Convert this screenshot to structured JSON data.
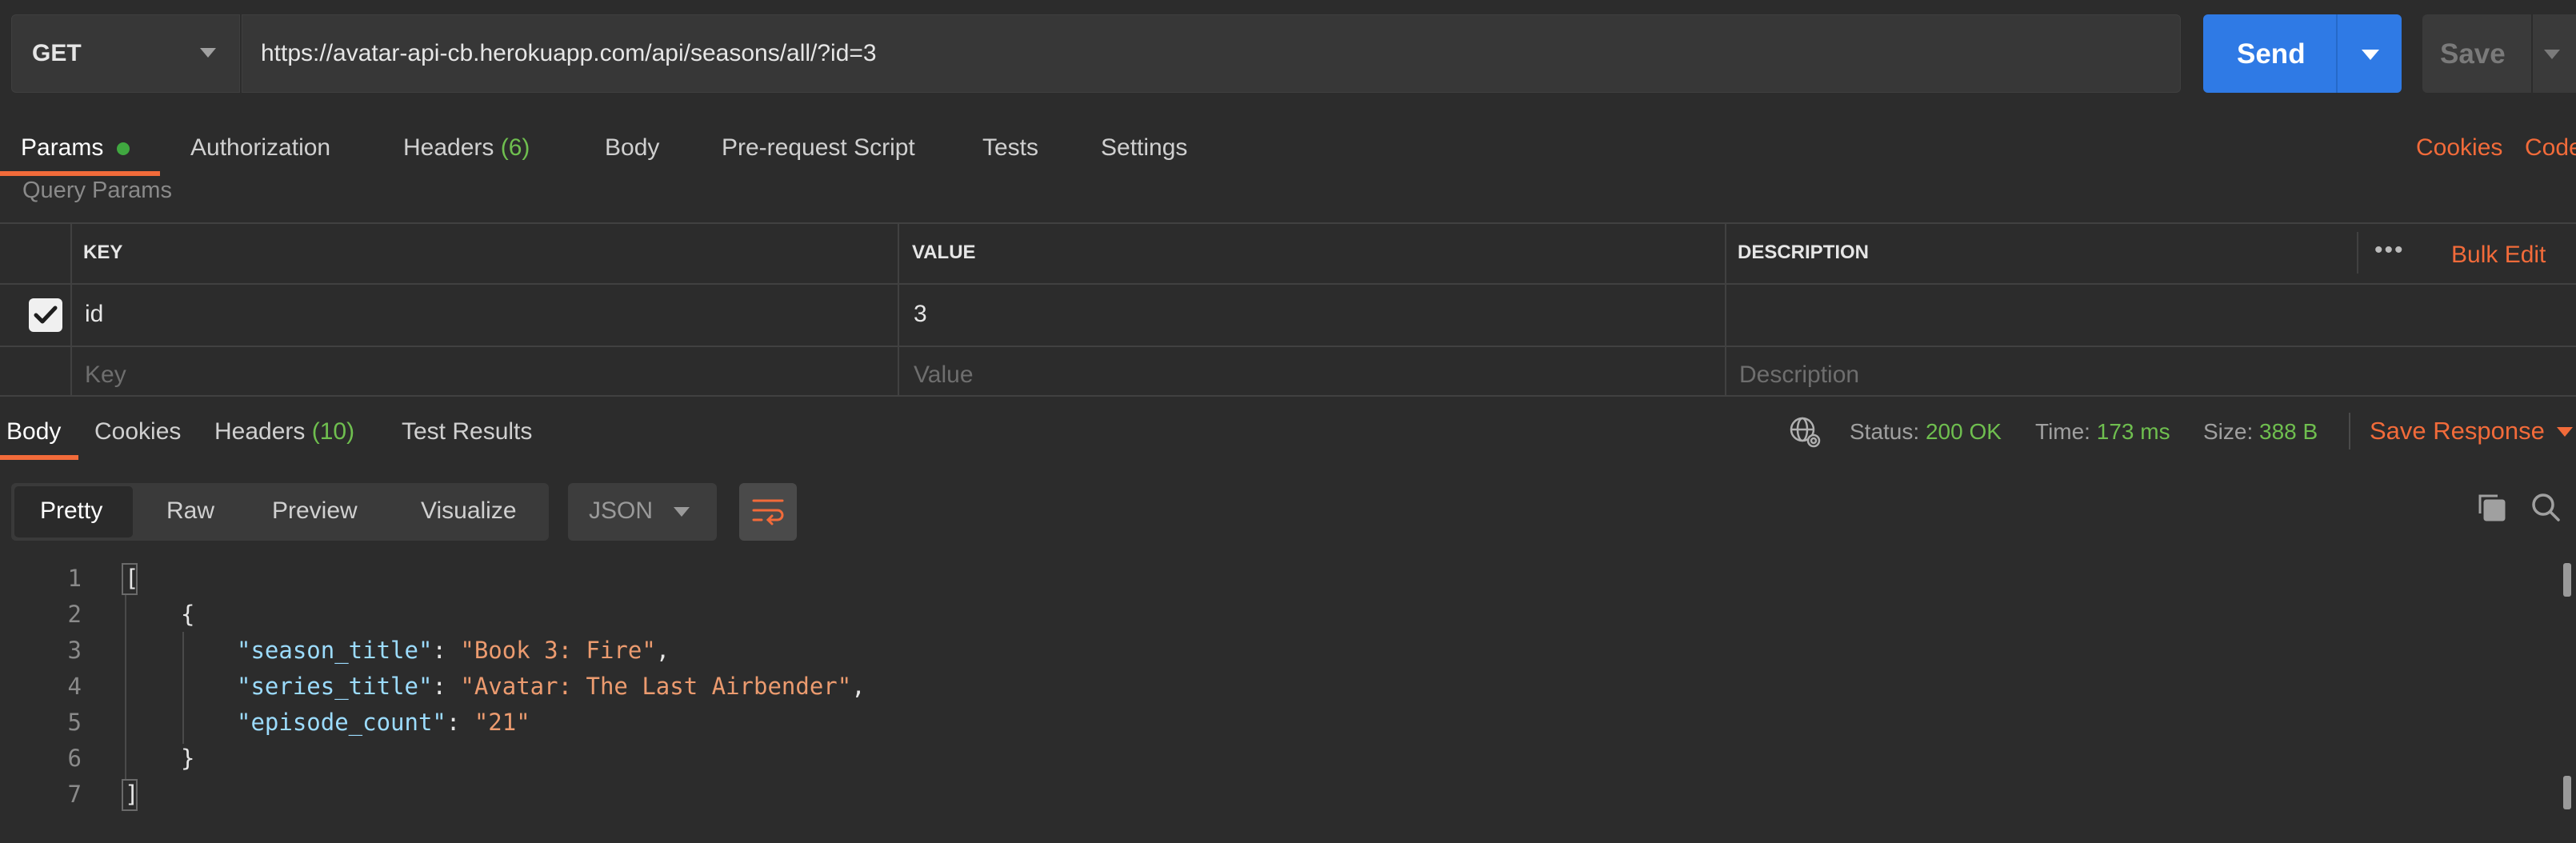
{
  "request": {
    "method": "GET",
    "url": "https://avatar-api-cb.herokuapp.com/api/seasons/all/?id=3",
    "send_label": "Send",
    "save_label": "Save"
  },
  "request_tabs": {
    "params": "Params",
    "authorization": "Authorization",
    "headers": "Headers",
    "headers_count": "(6)",
    "body": "Body",
    "prerequest": "Pre-request Script",
    "tests": "Tests",
    "settings": "Settings",
    "cookies": "Cookies",
    "code": "Code"
  },
  "params": {
    "section_title": "Query Params",
    "columns": {
      "key": "KEY",
      "value": "VALUE",
      "description": "DESCRIPTION"
    },
    "more_icon_glyph": "•••",
    "bulk_edit": "Bulk Edit",
    "rows": [
      {
        "key": "id",
        "value": "3",
        "description": "",
        "checked": true
      }
    ],
    "placeholders": {
      "key": "Key",
      "value": "Value",
      "description": "Description"
    }
  },
  "response_tabs": {
    "body": "Body",
    "cookies": "Cookies",
    "headers": "Headers",
    "headers_count": "(10)",
    "test_results": "Test Results"
  },
  "response_meta": {
    "status_label": "Status:",
    "status_value": "200 OK",
    "time_label": "Time:",
    "time_value": "173 ms",
    "size_label": "Size:",
    "size_value": "388 B",
    "save_response": "Save Response"
  },
  "view": {
    "modes": [
      "Pretty",
      "Raw",
      "Preview",
      "Visualize"
    ],
    "active": "Pretty",
    "format": "JSON"
  },
  "code": {
    "line_numbers": [
      "1",
      "2",
      "3",
      "4",
      "5",
      "6",
      "7"
    ],
    "open_array": "[",
    "open_obj": "{",
    "fields": [
      {
        "key": "\"season_title\"",
        "value": "\"Book 3: Fire\"",
        "trail": ","
      },
      {
        "key": "\"series_title\"",
        "value": "\"Avatar: The Last Airbender\"",
        "trail": ","
      },
      {
        "key": "\"episode_count\"",
        "value": "\"21\"",
        "trail": ""
      }
    ],
    "close_obj": "}",
    "close_array": "]"
  },
  "colors": {
    "accent": "#f26b3a",
    "send_blue": "#2f7ae5",
    "success_green": "#6fbf4f",
    "json_key": "#9cdcfe",
    "json_string": "#ec9b6f"
  },
  "icons": [
    "chevron-down-icon",
    "checkbox-checked-icon",
    "more-horizontal-icon",
    "globe-icon",
    "wrap-lines-icon",
    "copy-icon",
    "search-icon"
  ]
}
